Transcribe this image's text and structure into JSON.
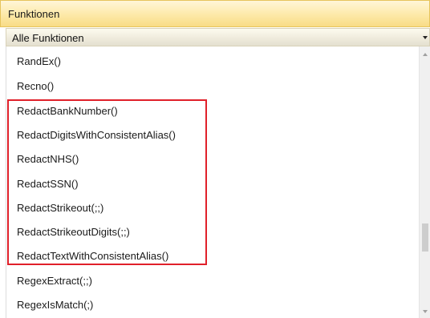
{
  "header": {
    "title": "Funktionen"
  },
  "filter": {
    "selected": "Alle Funktionen"
  },
  "functions": [
    "RandEx()",
    "Recno()",
    "RedactBankNumber()",
    "RedactDigitsWithConsistentAlias()",
    "RedactNHS()",
    "RedactSSN()",
    "RedactStrikeout(;;)",
    "RedactStrikeoutDigits(;;)",
    "RedactTextWithConsistentAlias()",
    "RegexExtract(;;)",
    "RegexIsMatch(;)"
  ],
  "highlight": {
    "color": "#e0202a"
  },
  "scrollbar": {
    "position": 0.72
  }
}
